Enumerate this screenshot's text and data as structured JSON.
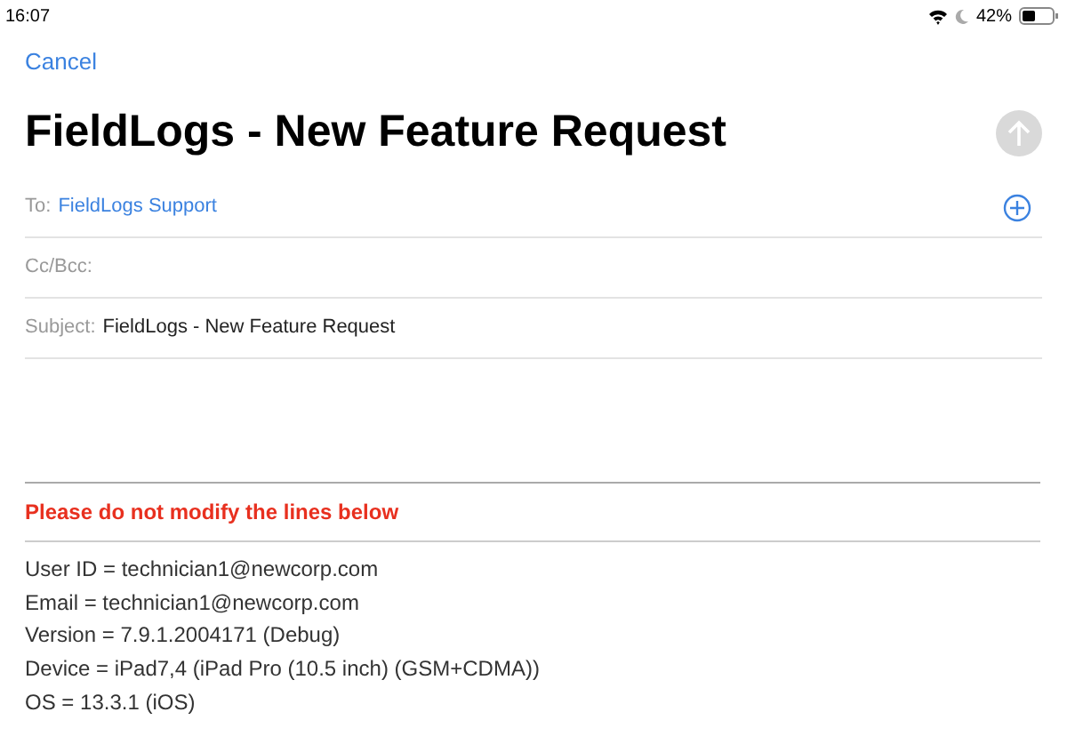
{
  "status_bar": {
    "time": "16:07",
    "battery": "42%"
  },
  "cancel": "Cancel",
  "title": "FieldLogs - New Feature Request",
  "send_button": {
    "disabled": true
  },
  "fields": [
    {
      "label": "To:",
      "value": "FieldLogs Support",
      "kind": "recipient"
    },
    {
      "label": "Cc/Bcc:",
      "kind": "empty"
    },
    {
      "label": "Subject:",
      "value": "FieldLogs - New Feature Request",
      "kind": "text"
    }
  ],
  "body": {
    "warning": "Please do not modify the lines below",
    "lines": [
      "User ID = technician1@newcorp.com",
      "Email = technician1@newcorp.com",
      "Version = 7.9.1.2004171 (Debug)",
      "Device = iPad7,4 (iPad Pro (10.5 inch) (GSM+CDMA))",
      "OS = 13.3.1 (iOS)"
    ]
  }
}
